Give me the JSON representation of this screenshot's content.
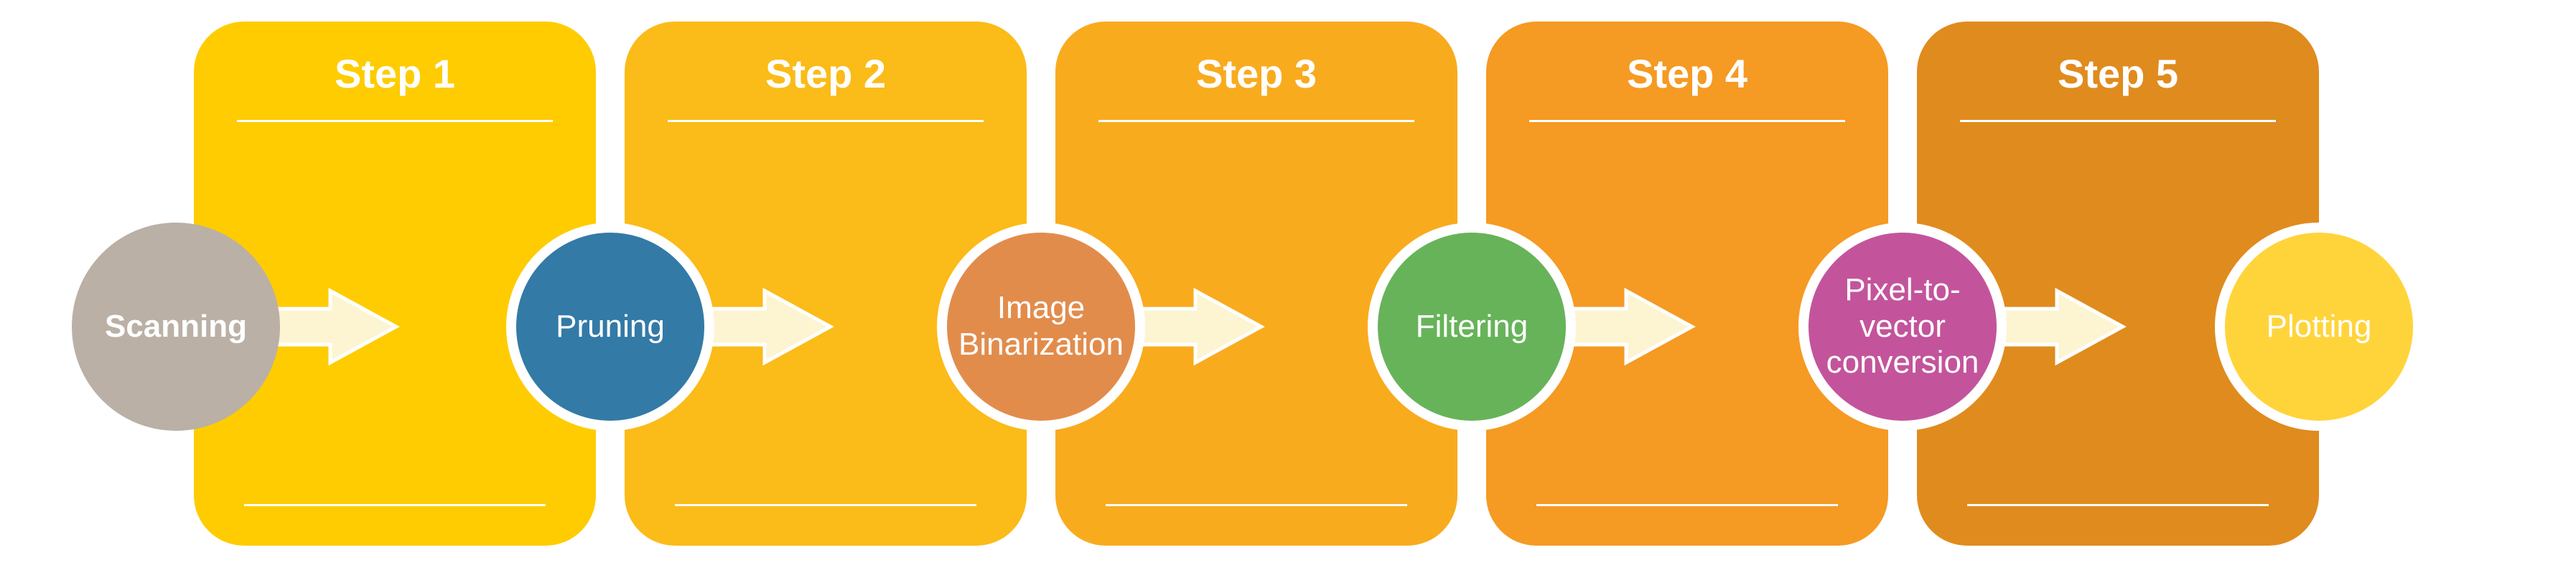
{
  "diagram": {
    "start": {
      "label": "Scanning",
      "fill": "#BAB0A6",
      "text": "#FFFFFF"
    },
    "end": {
      "label": "Plotting",
      "fill": "#FFD43B",
      "text": "#FFFFFF"
    },
    "steps": [
      {
        "title": "Step 1",
        "card_fill": "#FECC00",
        "circle_label": "Pruning",
        "circle_fill": "#337AA6",
        "circle_text": "#FFFFFF"
      },
      {
        "title": "Step 2",
        "card_fill": "#FBBB18",
        "circle_label": "Image Binarization",
        "circle_fill": "#E28C4C",
        "circle_text": "#FFFFFF"
      },
      {
        "title": "Step 3",
        "card_fill": "#F9AB1E",
        "circle_label": "Filtering",
        "circle_fill": "#67B35A",
        "circle_text": "#FFFFFF"
      },
      {
        "title": "Step 4",
        "card_fill": "#F59A23",
        "circle_label": "Pixel-to-vector conversion",
        "circle_fill": "#C3549B",
        "circle_text": "#FFFFFF"
      },
      {
        "title": "Step 5",
        "card_fill": "#E08B1E",
        "circle_label": "",
        "circle_fill": "",
        "circle_text": ""
      }
    ],
    "arrow": {
      "fill": "#FDF4D2",
      "stroke": "#FFFFFF"
    }
  }
}
